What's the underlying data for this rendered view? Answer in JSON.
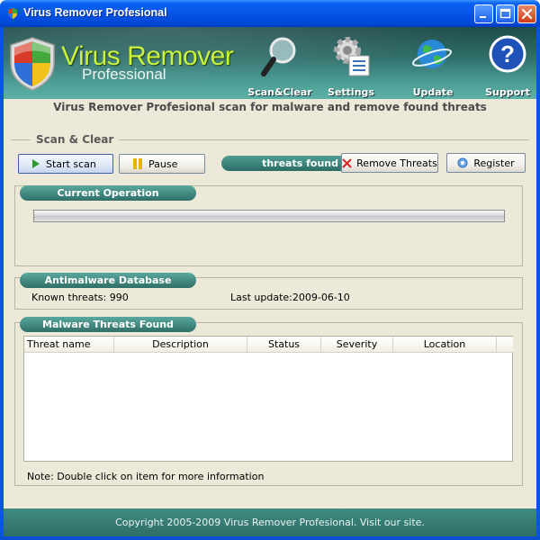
{
  "window": {
    "title": "Virus Remover Profesional"
  },
  "banner": {
    "brand_line1": "Virus Remover",
    "brand_line2": "Professional",
    "nav": [
      {
        "label": "Scan&Clear",
        "icon": "magnifier-icon"
      },
      {
        "label": "Settings",
        "icon": "gear-icon"
      },
      {
        "label": "Update",
        "icon": "globe-icon"
      },
      {
        "label": "Support",
        "icon": "help-icon"
      }
    ]
  },
  "subheader": "Virus Remover Profesional scan for malware and remove found threats",
  "scan_section": {
    "title": "Scan & Clear",
    "start_label": "Start scan",
    "pause_label": "Pause",
    "threats_found_label": "threats found",
    "remove_label": "Remove Threats",
    "register_label": "Register"
  },
  "current_operation": {
    "title": "Current Operation",
    "progress": 0
  },
  "database": {
    "title": "Antimalware Database",
    "known_threats": "Known threats: 990",
    "last_update": "Last update:2009-06-10"
  },
  "threats": {
    "title": "Malware Threats Found",
    "columns": [
      "Threat name",
      "Description",
      "Status",
      "Severity",
      "Location"
    ],
    "rows": [],
    "note": "Note: Double click on item for more information"
  },
  "footer": "Copyright 2005-2009 Virus Remover Profesional. Visit our site.",
  "colors": {
    "titlebar": "#0655e6",
    "banner": "#2d6b67",
    "brand_green": "#c9f23c",
    "pill": "#3d857d",
    "face": "#ece9d8"
  }
}
